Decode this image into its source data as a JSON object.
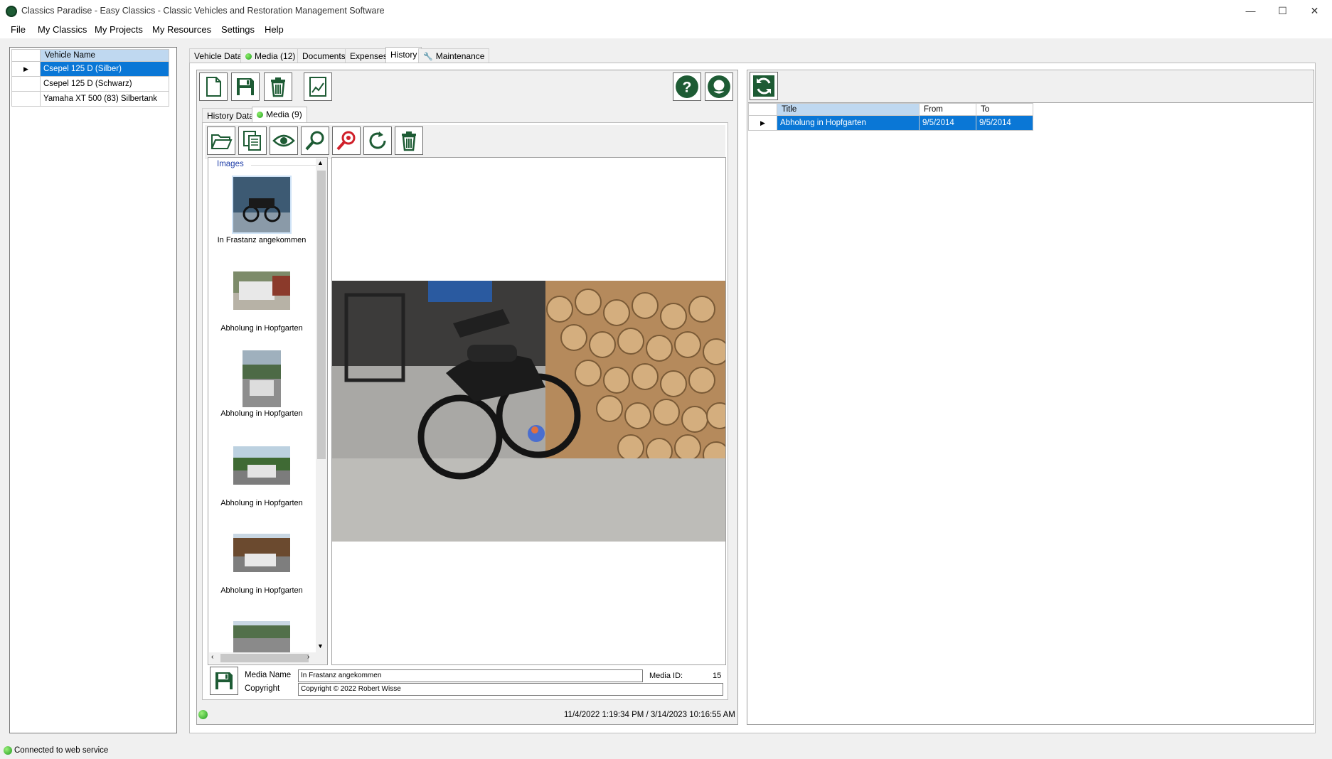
{
  "window": {
    "title": "Classics Paradise - Easy Classics - Classic Vehicles and Restoration Management Software",
    "minimize": "—",
    "maximize": "☐",
    "close": "✕"
  },
  "menu": [
    "File",
    "My Classics",
    "My Projects",
    "My Resources",
    "Settings",
    "Help"
  ],
  "vehicles": {
    "column_header": "Vehicle Name",
    "rows": [
      {
        "name": "Csepel 125 D (Silber)",
        "selected": true
      },
      {
        "name": "Csepel 125 D (Schwarz)",
        "selected": false
      },
      {
        "name": "Yamaha XT 500 (83) Silbertank",
        "selected": false
      }
    ]
  },
  "tabs": [
    {
      "label": "Vehicle Data",
      "active": false,
      "dot": false,
      "icon": null
    },
    {
      "label": "Media (12)",
      "active": false,
      "dot": true,
      "icon": null
    },
    {
      "label": "Documents",
      "active": false,
      "dot": false,
      "icon": null
    },
    {
      "label": "Expenses",
      "active": false,
      "dot": false,
      "icon": null
    },
    {
      "label": "History",
      "active": true,
      "dot": false,
      "icon": null
    },
    {
      "label": "Maintenance",
      "active": false,
      "dot": false,
      "icon": "wrench-icon"
    }
  ],
  "history": {
    "subtabs": [
      {
        "label": "History Data",
        "active": false
      },
      {
        "label": "Media (9)",
        "active": true
      }
    ],
    "images_label": "Images",
    "thumbnails": [
      {
        "caption": "In Frastanz angekommen",
        "selected": true
      },
      {
        "caption": "Abholung in Hopfgarten",
        "selected": false
      },
      {
        "caption": "Abholung in Hopfgarten",
        "selected": false
      },
      {
        "caption": "Abholung in Hopfgarten",
        "selected": false
      },
      {
        "caption": "Abholung in Hopfgarten",
        "selected": false
      },
      {
        "caption": "",
        "selected": false
      }
    ],
    "media_name_label": "Media Name",
    "media_name_value": "In Frastanz angekommen",
    "media_id_label": "Media ID:",
    "media_id_value": "15",
    "copyright_label": "Copyright",
    "copyright_value": "Copyright © 2022 Robert Wisse",
    "timestamps": "11/4/2022 1:19:34 PM / 3/14/2023 10:16:55 AM"
  },
  "history_grid": {
    "columns": [
      "Title",
      "From",
      "To"
    ],
    "rows": [
      {
        "title": "Abholung in Hopfgarten",
        "from": "9/5/2014",
        "to": "9/5/2014",
        "selected": true
      }
    ]
  },
  "status": {
    "text": "Connected to web service"
  },
  "colors": {
    "accent_green": "#1d5b34",
    "selection_blue": "#0a77d6",
    "header_blue": "#bfd8f0",
    "status_green": "#2bb42b"
  }
}
